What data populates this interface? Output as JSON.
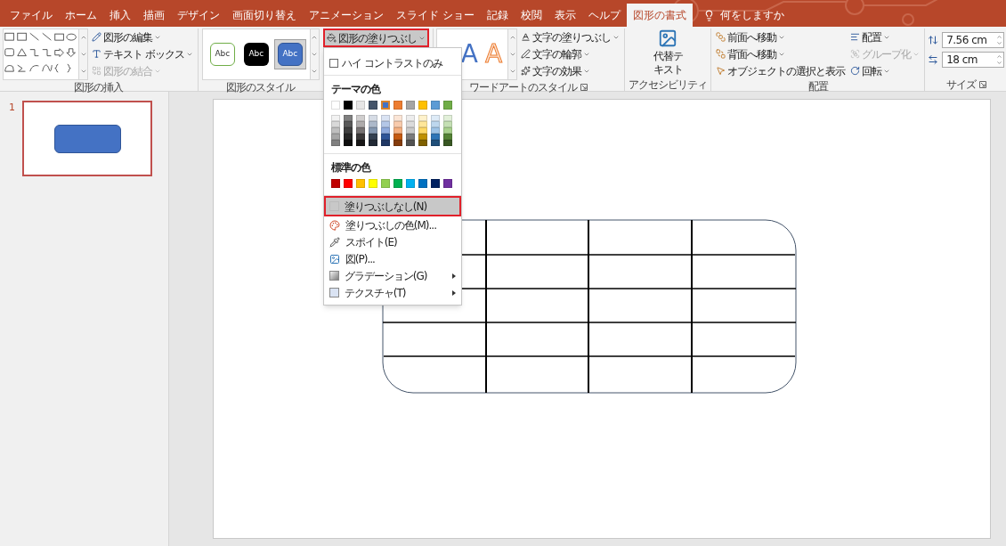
{
  "tabs": [
    {
      "label": "ファイル",
      "selected": false
    },
    {
      "label": "ホーム",
      "selected": false
    },
    {
      "label": "挿入",
      "selected": false
    },
    {
      "label": "描画",
      "selected": false
    },
    {
      "label": "デザイン",
      "selected": false
    },
    {
      "label": "画面切り替え",
      "selected": false
    },
    {
      "label": "アニメーション",
      "selected": false
    },
    {
      "label": "スライド ショー",
      "selected": false
    },
    {
      "label": "記録",
      "selected": false
    },
    {
      "label": "校閲",
      "selected": false
    },
    {
      "label": "表示",
      "selected": false
    },
    {
      "label": "ヘルプ",
      "selected": false
    },
    {
      "label": "図形の書式",
      "selected": true
    }
  ],
  "tell_me": {
    "label": "何をしますか"
  },
  "insert_shapes": {
    "buttons": [
      {
        "label": "図形の編集",
        "disabled": false
      },
      {
        "label": "テキスト ボックス",
        "disabled": false
      },
      {
        "label": "図形の結合",
        "disabled": true
      }
    ],
    "group_label": "図形の挿入"
  },
  "shape_styles": {
    "presets": [
      {
        "label": "Abc",
        "kind": "outline",
        "selected": false
      },
      {
        "label": "Abc",
        "kind": "dark",
        "selected": false
      },
      {
        "label": "Abc",
        "kind": "accent",
        "selected": true
      }
    ],
    "fill_button": {
      "label": "図形の塗りつぶし",
      "highlighted": true
    },
    "group_label": "図形のスタイル"
  },
  "wordart_styles": {
    "presets": [
      {
        "label": "A",
        "kind": "fill"
      },
      {
        "label": "A",
        "kind": "outline"
      }
    ],
    "buttons": [
      {
        "label": "文字の塗りつぶし"
      },
      {
        "label": "文字の輪郭"
      },
      {
        "label": "文字の効果"
      }
    ],
    "group_label": "ワードアートのスタイル",
    "dialog_launcher": true
  },
  "accessibility": {
    "button": {
      "label": "代替テキスト"
    },
    "group_label": "アクセシビリティ",
    "dialog_launcher": false
  },
  "arrange": {
    "buttons": [
      {
        "label": "前面へ移動",
        "disabled": false,
        "dropdown": true
      },
      {
        "label": "背面へ移動",
        "disabled": false,
        "dropdown": true
      },
      {
        "label": "オブジェクトの選択と表示",
        "disabled": false,
        "dropdown": false
      },
      {
        "label": "配置",
        "disabled": false,
        "dropdown": true
      },
      {
        "label": "グループ化",
        "disabled": true,
        "dropdown": true
      },
      {
        "label": "回転",
        "disabled": false,
        "dropdown": true
      }
    ],
    "group_label": "配置"
  },
  "size": {
    "fields": [
      {
        "value": "7.56 cm"
      },
      {
        "value": "18 cm"
      }
    ],
    "group_label": "サイズ",
    "dialog_launcher": true
  },
  "fill_menu": {
    "items": [
      {
        "kind": "checkbox",
        "label": "ハイ コントラストのみ",
        "checked": false
      },
      {
        "kind": "heading",
        "label": "テーマの色"
      },
      {
        "kind": "palette",
        "swatches": [
          {
            "color": "#ffffff",
            "selected": false
          },
          {
            "color": "#000000",
            "selected": false
          },
          {
            "color": "#e7e6e6",
            "selected": false
          },
          {
            "color": "#44546a",
            "selected": false
          },
          {
            "color": "#4472c4",
            "selected": true
          },
          {
            "color": "#ed7d31",
            "selected": false
          },
          {
            "color": "#a5a5a5",
            "selected": false
          },
          {
            "color": "#ffc000",
            "selected": false
          },
          {
            "color": "#5b9bd5",
            "selected": false
          },
          {
            "color": "#70ad47",
            "selected": false
          }
        ]
      },
      {
        "kind": "shades",
        "columns": [
          {
            "shades": [
              {
                "color": "#f2f2f2"
              },
              {
                "color": "#d9d9d9"
              },
              {
                "color": "#bfbfbf"
              },
              {
                "color": "#a6a6a6"
              },
              {
                "color": "#808080"
              }
            ]
          },
          {
            "shades": [
              {
                "color": "#7f7f7f"
              },
              {
                "color": "#595959"
              },
              {
                "color": "#404040"
              },
              {
                "color": "#262626"
              },
              {
                "color": "#0d0d0d"
              }
            ]
          },
          {
            "shades": [
              {
                "color": "#d0cece"
              },
              {
                "color": "#aeabab"
              },
              {
                "color": "#757171"
              },
              {
                "color": "#3a3838"
              },
              {
                "color": "#171616"
              }
            ]
          },
          {
            "shades": [
              {
                "color": "#d6dce5"
              },
              {
                "color": "#adb9ca"
              },
              {
                "color": "#8497b0"
              },
              {
                "color": "#333f50"
              },
              {
                "color": "#222a35"
              }
            ]
          },
          {
            "shades": [
              {
                "color": "#dae3f3"
              },
              {
                "color": "#b4c7e7"
              },
              {
                "color": "#8faadc"
              },
              {
                "color": "#2f5597"
              },
              {
                "color": "#203864"
              }
            ]
          },
          {
            "shades": [
              {
                "color": "#fbe5d6"
              },
              {
                "color": "#f8cbad"
              },
              {
                "color": "#f4b183"
              },
              {
                "color": "#c55a11"
              },
              {
                "color": "#843c0c"
              }
            ]
          },
          {
            "shades": [
              {
                "color": "#ededed"
              },
              {
                "color": "#dbdbdb"
              },
              {
                "color": "#c9c9c9"
              },
              {
                "color": "#7b7b7b"
              },
              {
                "color": "#525252"
              }
            ]
          },
          {
            "shades": [
              {
                "color": "#fff2cc"
              },
              {
                "color": "#ffe699"
              },
              {
                "color": "#ffd966"
              },
              {
                "color": "#bf9000"
              },
              {
                "color": "#7f6000"
              }
            ]
          },
          {
            "shades": [
              {
                "color": "#deebf7"
              },
              {
                "color": "#bdd7ee"
              },
              {
                "color": "#9dc3e6"
              },
              {
                "color": "#2e75b6"
              },
              {
                "color": "#1f4e79"
              }
            ]
          },
          {
            "shades": [
              {
                "color": "#e2f0d9"
              },
              {
                "color": "#c5e0b4"
              },
              {
                "color": "#a9d18e"
              },
              {
                "color": "#548235"
              },
              {
                "color": "#385723"
              }
            ]
          }
        ]
      },
      {
        "kind": "heading",
        "label": "標準の色"
      },
      {
        "kind": "palette",
        "swatches": [
          {
            "color": "#c00000",
            "selected": false
          },
          {
            "color": "#ff0000",
            "selected": false
          },
          {
            "color": "#ffc000",
            "selected": false
          },
          {
            "color": "#ffff00",
            "selected": false
          },
          {
            "color": "#92d050",
            "selected": false
          },
          {
            "color": "#00b050",
            "selected": false
          },
          {
            "color": "#00b0f0",
            "selected": false
          },
          {
            "color": "#0070c0",
            "selected": false
          },
          {
            "color": "#002060",
            "selected": false
          },
          {
            "color": "#7030a0",
            "selected": false
          }
        ]
      },
      {
        "kind": "command",
        "label": "塗りつぶしなし(N)",
        "highlighted": true,
        "submenu": false
      },
      {
        "kind": "command",
        "label": "塗りつぶしの色(M)...",
        "highlighted": false,
        "submenu": false
      },
      {
        "kind": "command",
        "label": "スポイト(E)",
        "highlighted": false,
        "submenu": false
      },
      {
        "kind": "command",
        "label": "図(P)...",
        "highlighted": false,
        "submenu": false
      },
      {
        "kind": "command",
        "label": "グラデーション(G)",
        "highlighted": false,
        "submenu": true
      },
      {
        "kind": "command",
        "label": "テクスチャ(T)",
        "highlighted": false,
        "submenu": true
      }
    ]
  },
  "slides": [
    {
      "number": "1",
      "selected": true
    }
  ]
}
